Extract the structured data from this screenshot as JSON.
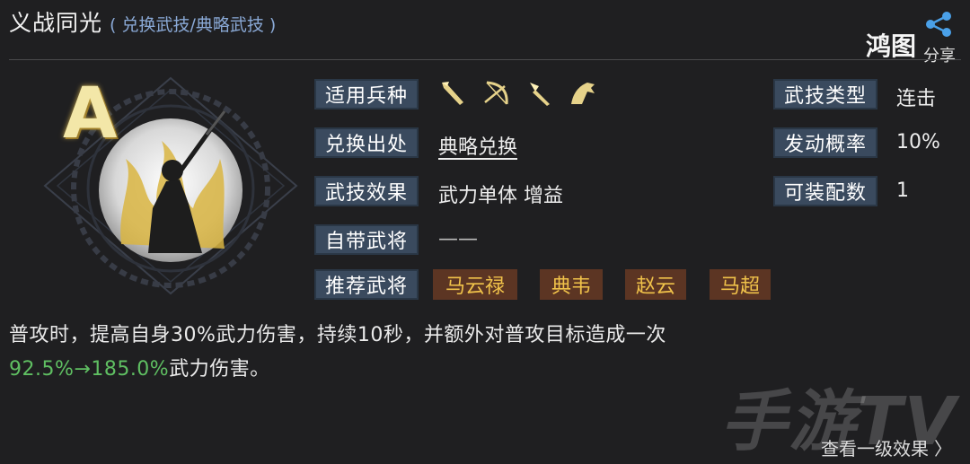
{
  "header": {
    "title": "义战同光",
    "subtitle": "( 兑换武技/典略武技 )"
  },
  "share": {
    "brand": "鸿图",
    "label": "分享"
  },
  "skill": {
    "grade": "A"
  },
  "fields": {
    "troop_label": "适用兵种",
    "troop_icons": [
      "spear-icon",
      "bow-icon",
      "blade-icon",
      "horse-icon"
    ],
    "source_label": "兑换出处",
    "source_value": "典略兑换",
    "effect_label": "武技效果",
    "effect_value": "武力单体 增益",
    "own_general_label": "自带武将",
    "own_general_value": "——",
    "recommend_label": "推荐武将",
    "recommended": [
      "马云禄",
      "典韦",
      "赵云",
      "马超"
    ],
    "type_label": "武技类型",
    "type_value": "连击",
    "rate_label": "发动概率",
    "rate_value": "10%",
    "equip_label": "可装配数",
    "equip_value": "1"
  },
  "description": {
    "line1": "普攻时，提高自身30%武力伤害，持续10秒，并额外对普攻目标造成一次",
    "scaling": "92.5%→185.0%",
    "line2_tail": "武力伤害。"
  },
  "footer": {
    "more_label": "查看一级效果",
    "more_icon": "chevron-right-icon",
    "watermark": "手游TV"
  },
  "colors": {
    "background": "#1f1f21",
    "label_bg": "#3a4a5e",
    "tag_bg": "#5c3523",
    "tag_text": "#f0c24a",
    "scaling": "#5fbf62",
    "subtitle": "#8aa9d6"
  }
}
